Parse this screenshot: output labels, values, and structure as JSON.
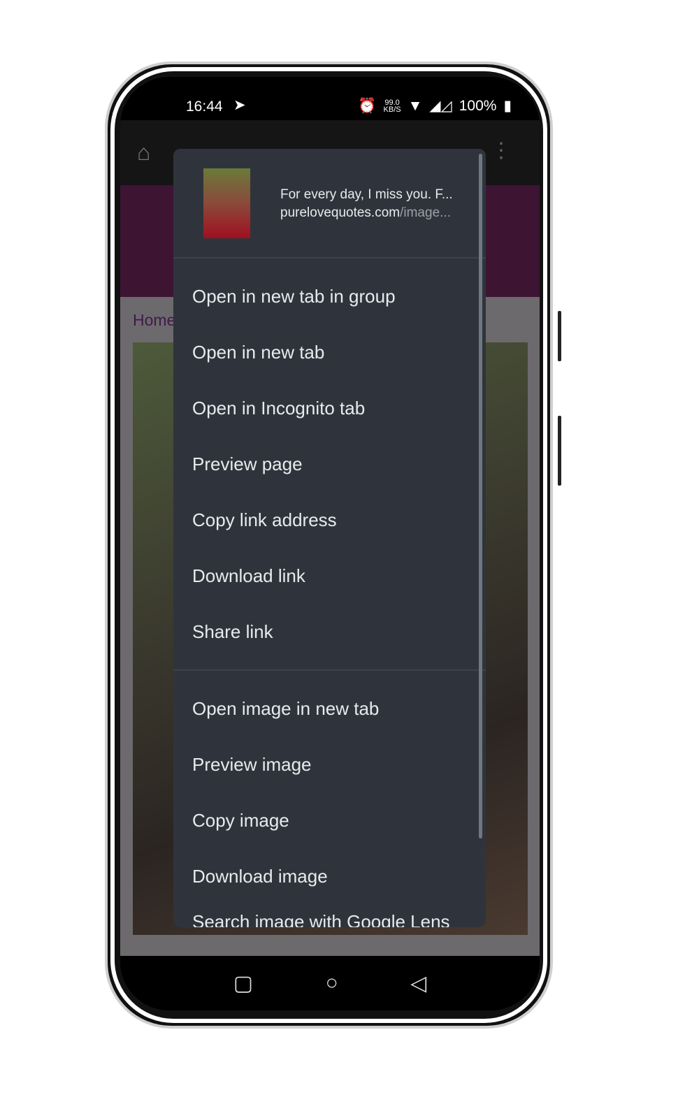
{
  "status": {
    "time": "16:44",
    "speed": "99.0",
    "speed_unit": "KB/S",
    "battery": "100%"
  },
  "page": {
    "breadcrumb": "Home"
  },
  "menu": {
    "title": "For every day, I miss you. F...",
    "url_domain": "purelovequotes.com",
    "url_path": "/image...",
    "link_items": [
      "Open in new tab in group",
      "Open in new tab",
      "Open in Incognito tab",
      "Preview page",
      "Copy link address",
      "Download link",
      "Share link"
    ],
    "image_items": [
      "Open image in new tab",
      "Preview image",
      "Copy image",
      "Download image",
      "Search image with Google Lens"
    ]
  }
}
